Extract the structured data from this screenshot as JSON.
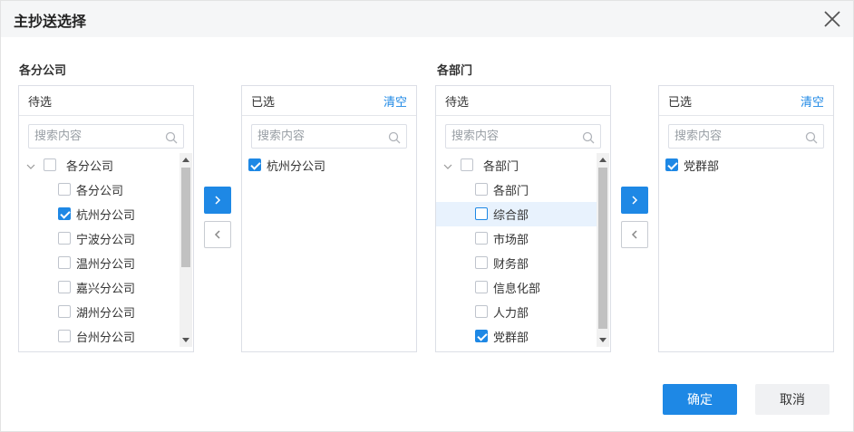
{
  "dialog": {
    "title": "主抄送选择",
    "confirm_label": "确定",
    "cancel_label": "取消"
  },
  "left_group": {
    "label": "各分公司",
    "candidates": {
      "header": "待选",
      "search_placeholder": "搜索内容",
      "root": {
        "label": "各分公司",
        "checked": false,
        "expanded": true
      },
      "items": [
        {
          "label": "各分公司",
          "checked": false
        },
        {
          "label": "杭州分公司",
          "checked": true
        },
        {
          "label": "宁波分公司",
          "checked": false
        },
        {
          "label": "温州分公司",
          "checked": false
        },
        {
          "label": "嘉兴分公司",
          "checked": false
        },
        {
          "label": "湖州分公司",
          "checked": false
        },
        {
          "label": "台州分公司",
          "checked": false
        }
      ]
    },
    "selected": {
      "header": "已选",
      "clear_label": "清空",
      "search_placeholder": "搜索内容",
      "items": [
        {
          "label": "杭州分公司",
          "checked": true
        }
      ]
    }
  },
  "right_group": {
    "label": "各部门",
    "candidates": {
      "header": "待选",
      "search_placeholder": "搜索内容",
      "root": {
        "label": "各部门",
        "checked": false,
        "expanded": true
      },
      "items": [
        {
          "label": "各部门",
          "checked": false
        },
        {
          "label": "综合部",
          "checked": false,
          "highlighted": true
        },
        {
          "label": "市场部",
          "checked": false
        },
        {
          "label": "财务部",
          "checked": false
        },
        {
          "label": "信息化部",
          "checked": false
        },
        {
          "label": "人力部",
          "checked": false
        },
        {
          "label": "党群部",
          "checked": true
        }
      ]
    },
    "selected": {
      "header": "已选",
      "clear_label": "清空",
      "search_placeholder": "搜索内容",
      "items": [
        {
          "label": "党群部",
          "checked": true
        }
      ]
    }
  },
  "icons": {
    "close": "close-icon",
    "search": "search-icon",
    "collapse": "chevron-down-icon",
    "move_right": "chevron-right-icon",
    "move_left": "chevron-left-icon"
  },
  "colors": {
    "accent": "#1e88e5",
    "header_bg": "#f5f6f7",
    "highlight_row": "#e8f2fd"
  }
}
